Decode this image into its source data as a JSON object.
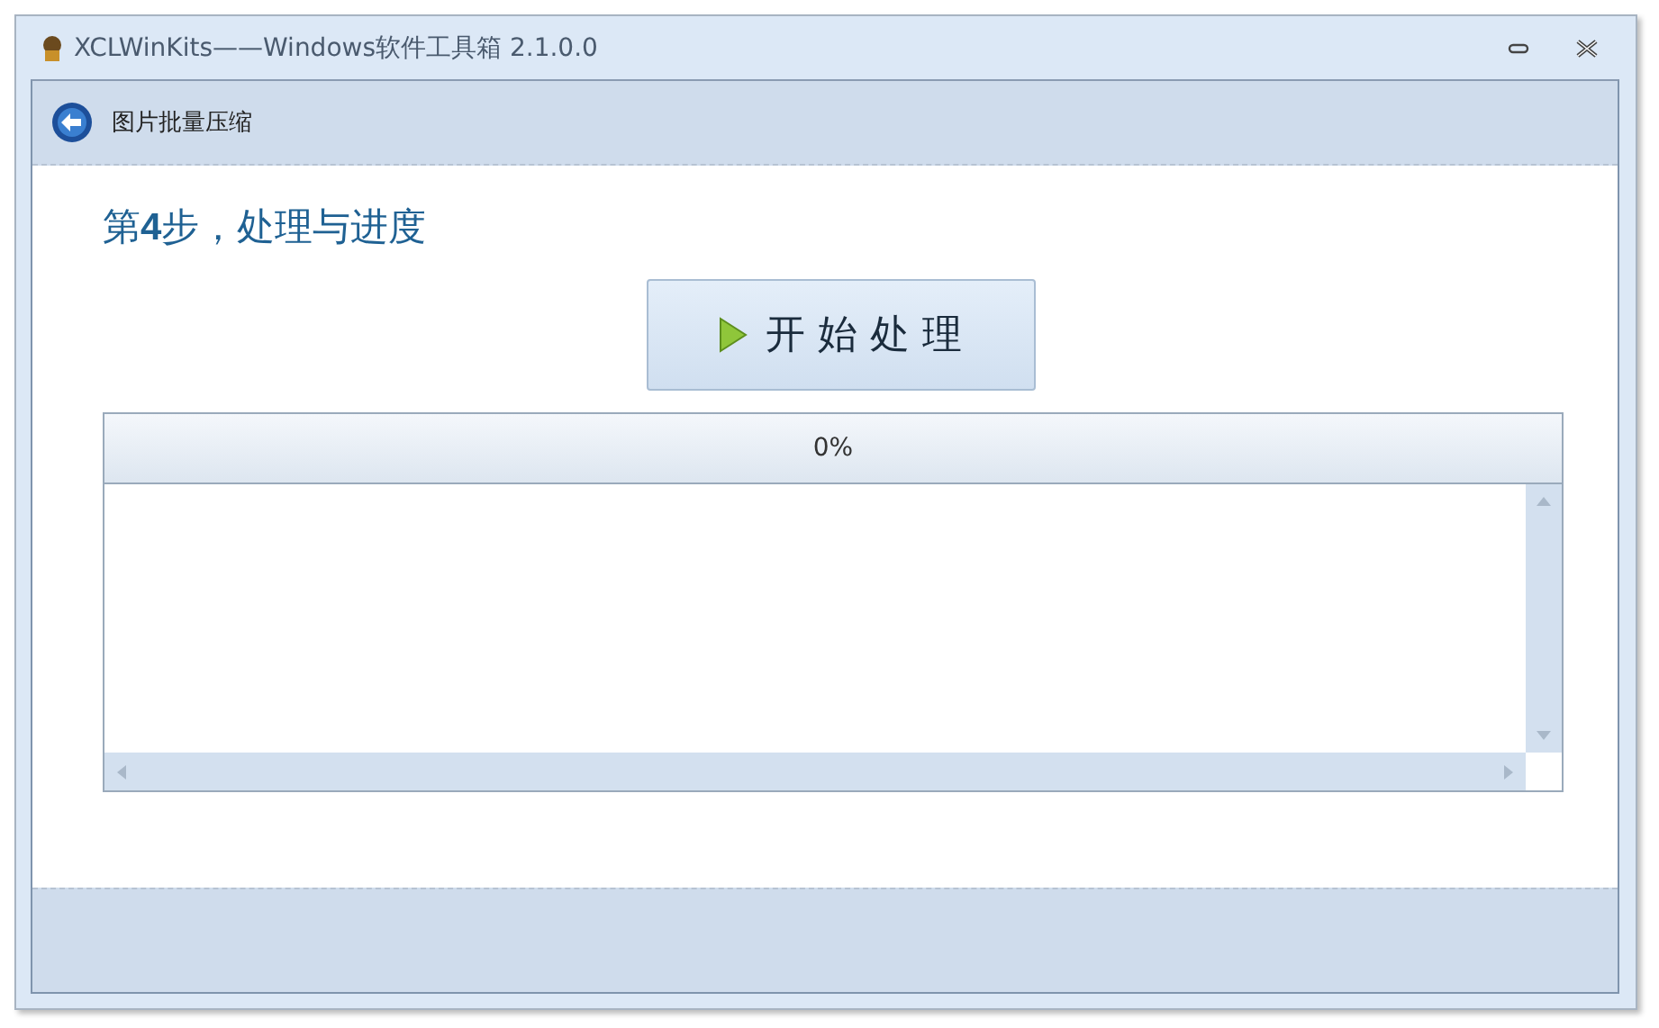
{
  "window": {
    "title": "XCLWinKits——Windows软件工具箱 2.1.0.0"
  },
  "header": {
    "title": "图片批量压缩"
  },
  "step": {
    "title": "第**4**步，处理与进度"
  },
  "start_button": {
    "label": "开 始 处 理"
  },
  "progress": {
    "level": 0,
    "reading": "0%"
  }
}
